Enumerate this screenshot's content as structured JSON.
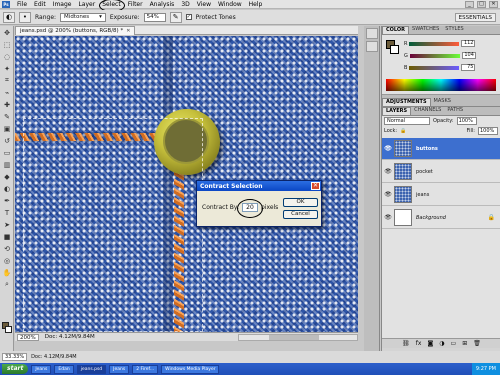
{
  "menubar": {
    "logo": "Ps",
    "items": [
      "File",
      "Edit",
      "Image",
      "Layer",
      "Select",
      "Filter",
      "Analysis",
      "3D",
      "View",
      "Window",
      "Help"
    ]
  },
  "options": {
    "range_label": "Range:",
    "range_value": "Midtones",
    "exposure_label": "Exposure:",
    "exposure_value": "54%",
    "protect_label": "Protect Tones",
    "workspace": "ESSENTIALS"
  },
  "document": {
    "tab_title": "jeans.psd @ 200% (buttons, RGB/8) *",
    "zoom": "200%",
    "doc_size": "Doc: 4.12M/9.84M"
  },
  "dialog": {
    "title": "Contract Selection",
    "label_before": "Contract By:",
    "value": "20",
    "label_after": "pixels",
    "ok": "OK",
    "cancel": "Cancel"
  },
  "color_panel": {
    "tabs": [
      "COLOR",
      "SWATCHES",
      "STYLES"
    ],
    "channels": [
      {
        "name": "R",
        "value": "112"
      },
      {
        "name": "G",
        "value": "104"
      },
      {
        "name": "B",
        "value": "75"
      }
    ]
  },
  "adjustments_tabs": [
    "ADJUSTMENTS",
    "MASKS"
  ],
  "layers_panel": {
    "tabs": [
      "LAYERS",
      "CHANNELS",
      "PATHS"
    ],
    "blend_mode": "Normal",
    "opacity_label": "Opacity:",
    "opacity": "100%",
    "lock_label": "Lock:",
    "fill_label": "Fill:",
    "fill": "100%",
    "layers": [
      {
        "name": "buttons",
        "selected": true
      },
      {
        "name": "pocket",
        "selected": false
      },
      {
        "name": "jeans",
        "selected": false
      },
      {
        "name": "Background",
        "selected": false
      }
    ]
  },
  "bottom_status": {
    "zoom": "33.33%",
    "doc_size": "Doc: 4.12M/9.84M"
  },
  "taskbar": {
    "start": "start",
    "tasks": [
      "Jeans",
      "Edan",
      "jeans.psd",
      "Jeans",
      "2 Firef...",
      "Windows Media Player"
    ],
    "clock": "9:27 PM"
  }
}
